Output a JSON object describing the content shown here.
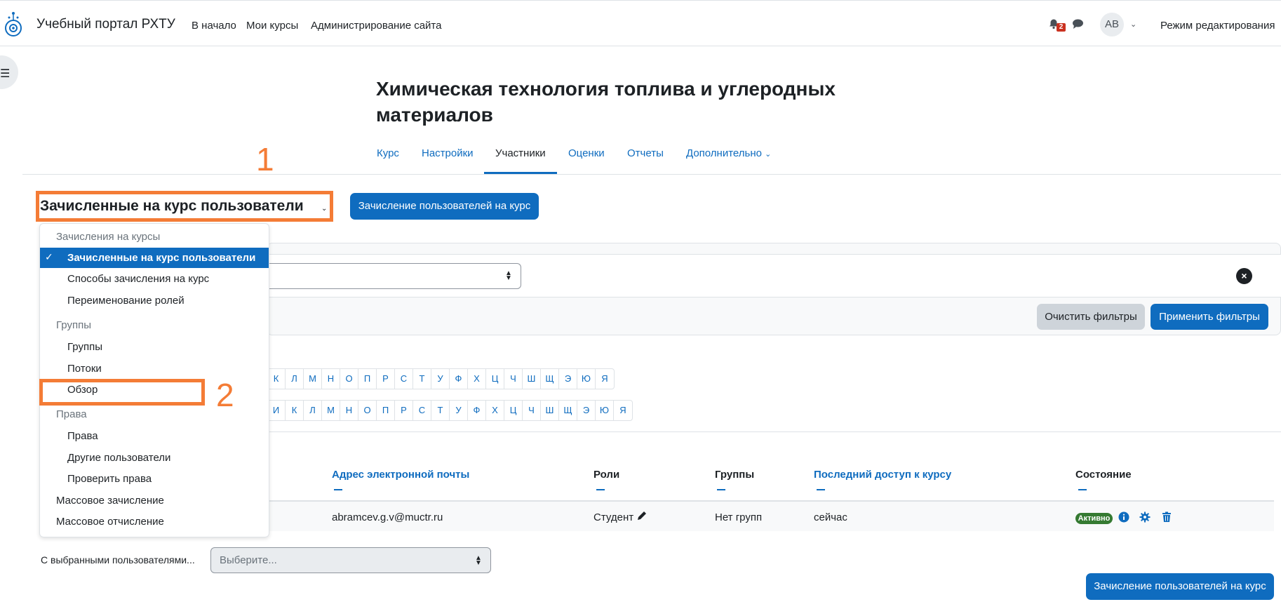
{
  "header": {
    "site_name": "Учебный портал РХТУ",
    "nav": [
      "В начало",
      "Мои курсы",
      "Администрирование сайта"
    ],
    "notification_count": "2",
    "avatar_initials": "АВ",
    "edit_mode_label": "Режим редактирования"
  },
  "course": {
    "title": "Химическая технология топлива и углеродных материалов",
    "tabs": [
      "Курс",
      "Настройки",
      "Участники",
      "Оценки",
      "Отчеты",
      "Дополнительно"
    ],
    "active_tab": "Участники"
  },
  "annotations": {
    "step1": "1",
    "step2": "2",
    "accent_color": "#f47c36"
  },
  "participants": {
    "page_select_value": "Зачисленные на курс пользователи",
    "enrol_button": "Зачисление пользователей на курс",
    "clear_filters": "Очистить фильтры",
    "apply_filters": "Применить фильтры",
    "letters_row1": [
      "К",
      "Л",
      "М",
      "Н",
      "О",
      "П",
      "Р",
      "С",
      "Т",
      "У",
      "Ф",
      "Х",
      "Ц",
      "Ч",
      "Ш",
      "Щ",
      "Э",
      "Ю",
      "Я"
    ],
    "letters_row2": [
      "И",
      "К",
      "Л",
      "М",
      "Н",
      "О",
      "П",
      "Р",
      "С",
      "Т",
      "У",
      "Ф",
      "Х",
      "Ц",
      "Ч",
      "Ш",
      "Щ",
      "Э",
      "Ю",
      "Я"
    ],
    "columns": {
      "email": "Адрес электронной почты",
      "roles": "Роли",
      "groups": "Группы",
      "last_access": "Последний доступ к курсу",
      "status": "Состояние"
    },
    "row": {
      "email": "abramcev.g.v@muctr.ru",
      "role": "Студент",
      "groups": "Нет групп",
      "last_access": "сейчас",
      "status": "Активно"
    },
    "bulk_label": "С выбранными пользователями...",
    "bulk_placeholder": "Выберите...",
    "enrol_button_bottom": "Зачисление пользователей на курс"
  },
  "dropdown": {
    "group1_head": "Зачисления на курсы",
    "group1_items": [
      "Зачисленные на курс пользователи",
      "Способы зачисления на курс",
      "Переименование ролей"
    ],
    "group2_head": "Группы",
    "group2_items": [
      "Группы",
      "Потоки",
      "Обзор"
    ],
    "group3_head": "Права",
    "group3_items": [
      "Права",
      "Другие пользователи",
      "Проверить права"
    ],
    "other_items": [
      "Массовое зачисление",
      "Массовое отчисление"
    ]
  }
}
